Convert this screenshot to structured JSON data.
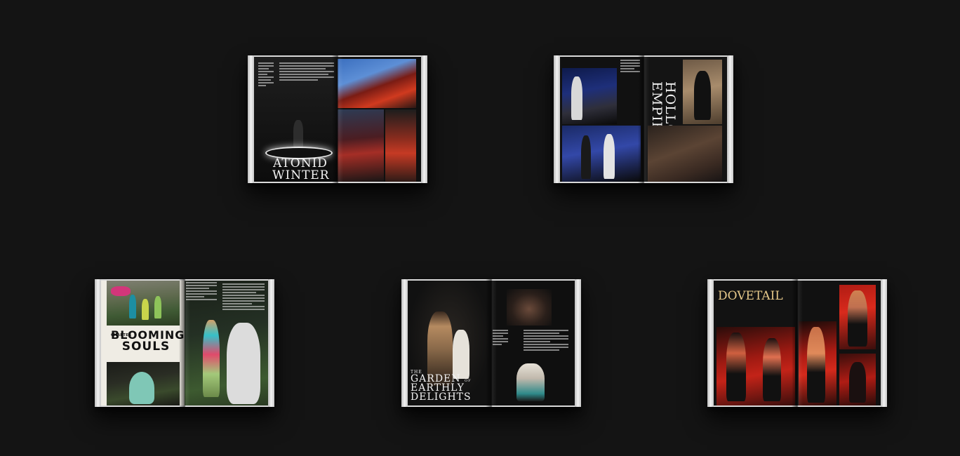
{
  "scene": {
    "background": "#141414",
    "description_free": true
  },
  "magazines": [
    {
      "id": "atonid-winter",
      "title_line1": "ATONID",
      "title_line2": "WINTER"
    },
    {
      "id": "hollow-empire",
      "title_line1": "HOLLOW",
      "title_line2": "EMPIRE"
    },
    {
      "id": "blooming-souls",
      "title_line1": "BLOOMING",
      "title_line2": "SOULS",
      "kicker": "CHAPTER"
    },
    {
      "id": "garden",
      "title_line1": "THE",
      "title_line2": "GARDEN",
      "title_line3": "OF",
      "title_line4": "EARTHLY",
      "title_line5": "DELIGHTS"
    },
    {
      "id": "dovetail",
      "title_line1": "DOVETAIL"
    }
  ]
}
